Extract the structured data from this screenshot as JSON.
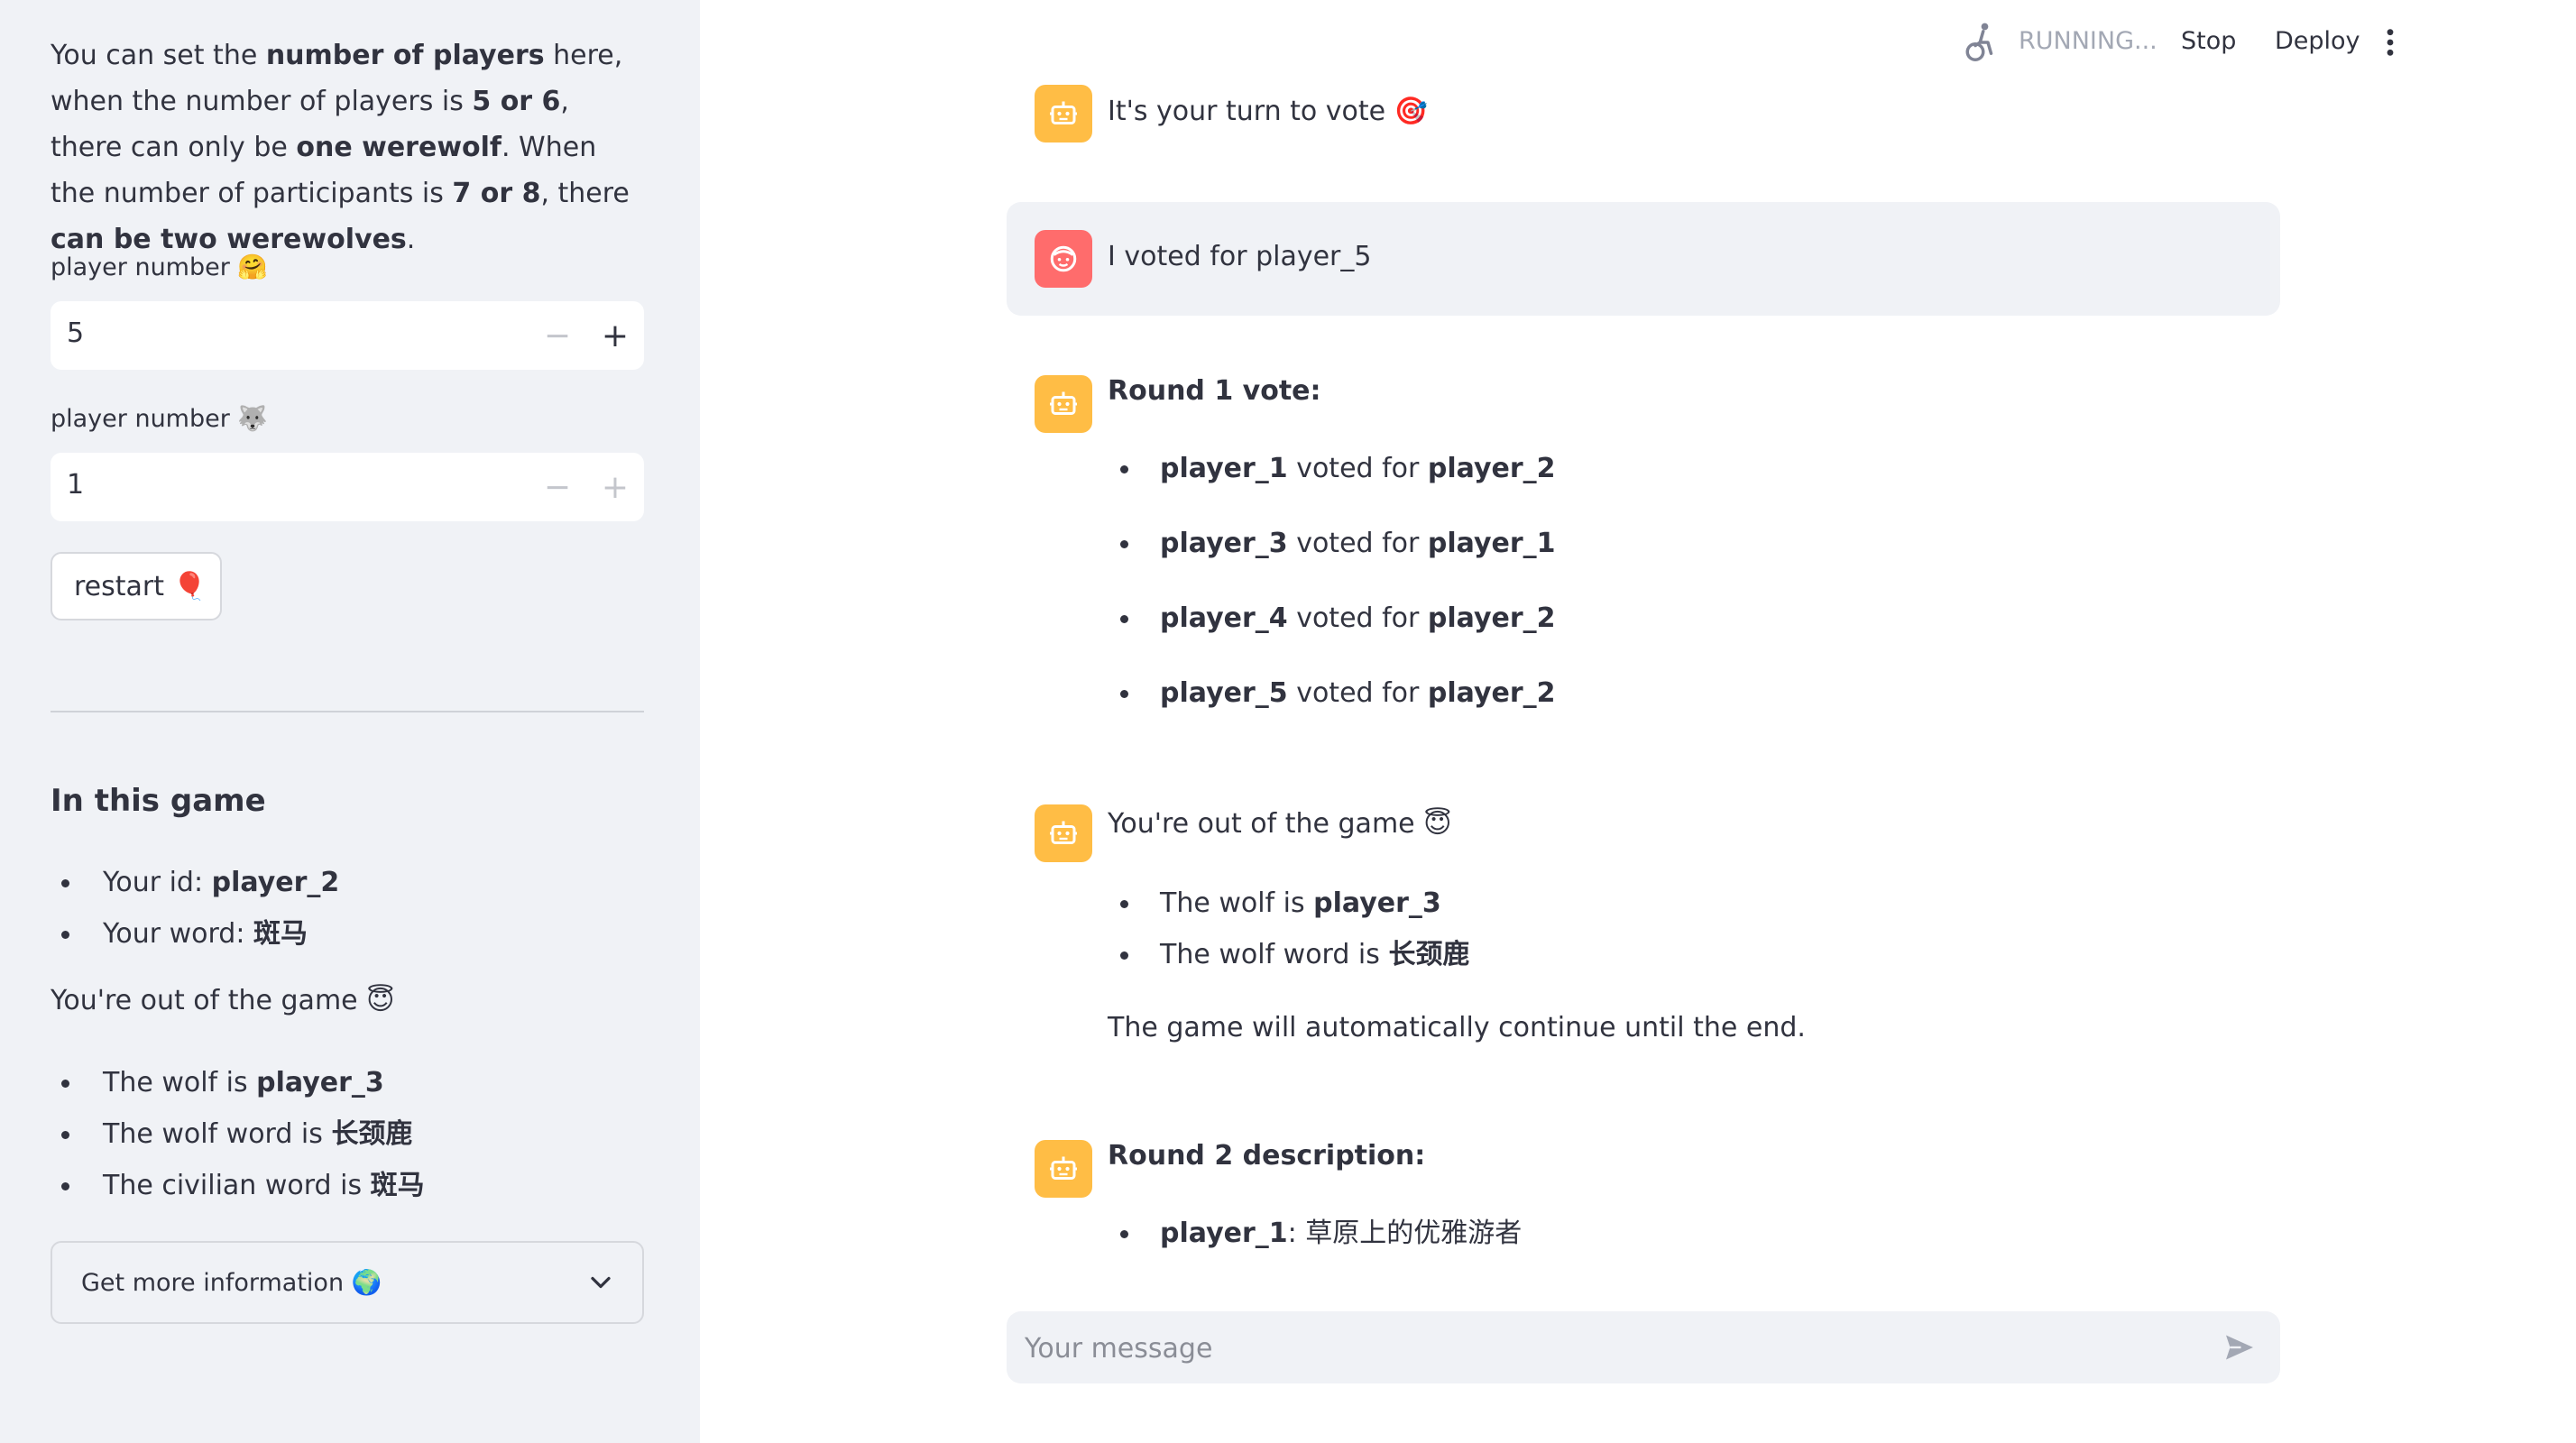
{
  "sidebar": {
    "intro": {
      "p1": "You can set the ",
      "b1": "number of players",
      "p2": " here, when the number of players is ",
      "b2": "5 or 6",
      "p3": ", there can only be ",
      "b3": "one werewolf",
      "p4": ". When the number of participants is ",
      "b4": "7 or 8",
      "p5": ", there ",
      "b5": "can be two werewolves",
      "p6": "."
    },
    "players_field": {
      "label": "player number 🤗",
      "value": "5"
    },
    "wolves_field": {
      "label": "player number 🐺",
      "value": "1"
    },
    "restart_label": "restart 🎈",
    "game_heading": "In this game",
    "id_label": "Your id: ",
    "id_value": "player_2",
    "word_label": "Your word: ",
    "word_value": "斑马",
    "out_text": "You're out of the game 😇",
    "wolf_label": "The wolf is ",
    "wolf_value": "player_3",
    "wolf_word_label": "The wolf word is ",
    "wolf_word_value": "长颈鹿",
    "civilian_word_label": "The civilian word is ",
    "civilian_word_value": "斑马",
    "expander_label": "Get more information 🌍"
  },
  "header": {
    "status": "RUNNING...",
    "stop": "Stop",
    "deploy": "Deploy"
  },
  "chat": {
    "msg1": "It's your turn to vote 🎯",
    "user_msg": "I voted for player_5",
    "round1_title": "Round 1 vote:",
    "voted_for": " voted for ",
    "votes": [
      {
        "voter": "player_1",
        "target": "player_2"
      },
      {
        "voter": "player_3",
        "target": "player_1"
      },
      {
        "voter": "player_4",
        "target": "player_2"
      },
      {
        "voter": "player_5",
        "target": "player_2"
      }
    ],
    "out_msg": "You're out of the game 😇",
    "wolf_label": "The wolf is ",
    "wolf_value": "player_3",
    "wolf_word_label": "The wolf word is ",
    "wolf_word_value": "长颈鹿",
    "continue_text": "The game will automatically continue until the end.",
    "round2_title": "Round 2 description:",
    "desc_player": "player_1",
    "desc_text": ": 草原上的优雅游者"
  },
  "input": {
    "placeholder": "Your message"
  },
  "icons": {
    "bot": "robot-icon",
    "user": "user-face-icon",
    "send": "send-icon",
    "status": "running-figure-icon",
    "menu": "kebab-menu-icon",
    "chevron": "chevron-down-icon"
  },
  "colors": {
    "bot_avatar": "#ffbd45",
    "user_avatar": "#ff6c6c",
    "sidebar_bg": "#f0f2f6",
    "text": "#31333f"
  }
}
